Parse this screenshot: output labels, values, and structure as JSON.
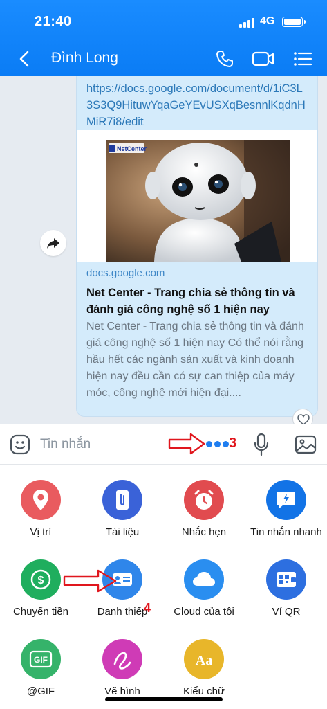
{
  "status_bar": {
    "time": "21:40",
    "network": "4G"
  },
  "header": {
    "title": "Đình Long"
  },
  "message": {
    "url": "https://docs.google.com/document/d/1iC3L3S3Q9HituwYqaGeYEvUSXqBesnnlKqdnHMiR7i8/edit",
    "preview_logo": "NetCenter",
    "domain": "docs.google.com",
    "title": "Net Center - Trang chia sẻ thông tin và đánh giá công nghệ số 1 hiện nay",
    "description": "Net Center - Trang chia sẻ thông tin và đánh giá công nghệ số 1 hiện nay  Có thể nói rằng hầu hết các ngành sản xuất và kinh doanh hiện nay đều cần có sự can thiệp của máy móc, công nghệ mới hiện đại...."
  },
  "input": {
    "placeholder": "Tin nhắn"
  },
  "annotations": {
    "step3": "3",
    "step4": "4"
  },
  "tools": [
    {
      "label": "Vị trí",
      "icon": "location-icon",
      "color": "#e95b5f"
    },
    {
      "label": "Tài liệu",
      "icon": "paperclip-icon",
      "color": "#3a62d8"
    },
    {
      "label": "Nhắc hẹn",
      "icon": "alarm-clock-icon",
      "color": "#e14b4f"
    },
    {
      "label": "Tin nhắn nhanh",
      "icon": "quick-message-icon",
      "color": "#1273e6"
    },
    {
      "label": "Chuyển tiền",
      "icon": "money-transfer-icon",
      "color": "#1fae5e"
    },
    {
      "label": "Danh thiếp",
      "icon": "business-card-icon",
      "color": "#2f86ea"
    },
    {
      "label": "Cloud của tôi",
      "icon": "cloud-icon",
      "color": "#2a8ef0"
    },
    {
      "label": "Ví QR",
      "icon": "qr-wallet-icon",
      "color": "#2d6fe0"
    },
    {
      "label": "@GIF",
      "icon": "gif-icon",
      "color": "#35b36a"
    },
    {
      "label": "Vẽ hình",
      "icon": "draw-icon",
      "color": "#cf3bb6"
    },
    {
      "label": "Kiểu chữ",
      "icon": "font-style-icon",
      "color": "#e8b62a"
    }
  ]
}
